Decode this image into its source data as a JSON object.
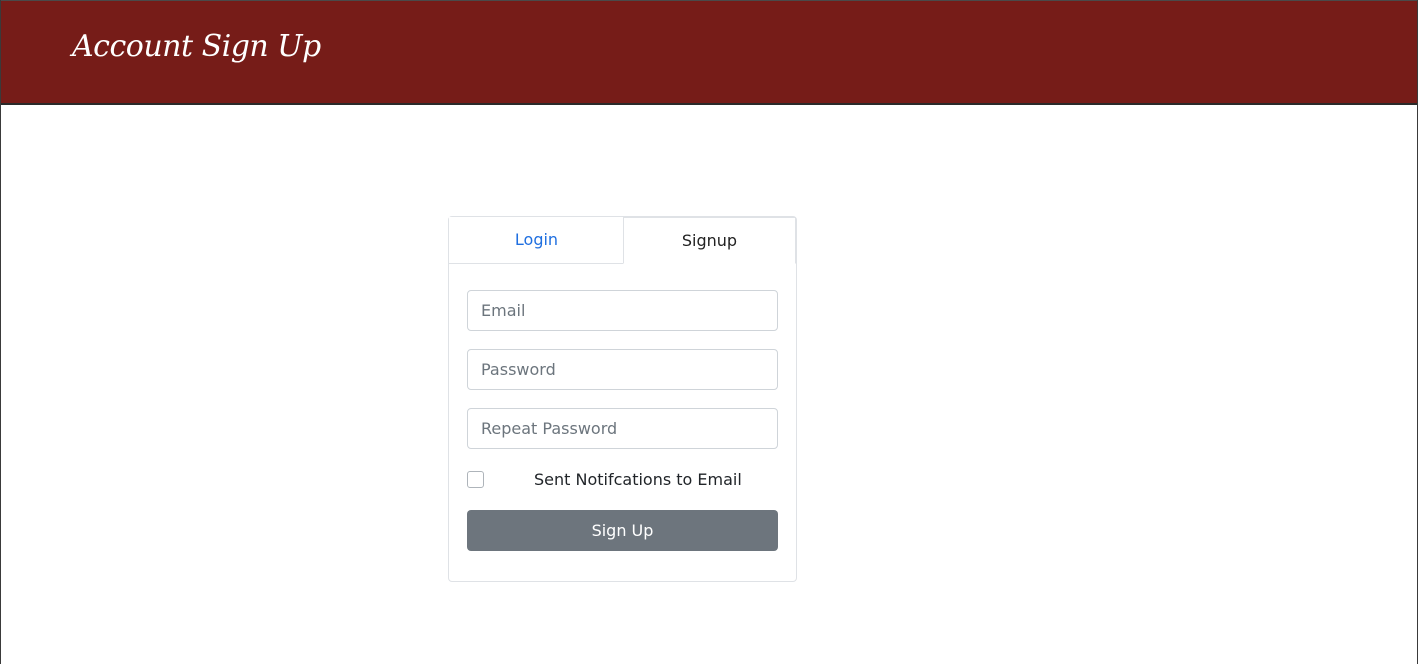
{
  "header": {
    "title": "Account Sign Up",
    "background_color": "#761c18"
  },
  "tabs": [
    {
      "label": "Login",
      "active": false,
      "color": "#1f6fe0"
    },
    {
      "label": "Signup",
      "active": true,
      "color": "#222222"
    }
  ],
  "form": {
    "email": {
      "placeholder": "Email",
      "value": ""
    },
    "password": {
      "placeholder": "Password",
      "value": ""
    },
    "repeat_password": {
      "placeholder": "Repeat Password",
      "value": ""
    },
    "notifications": {
      "label": "Sent Notifcations to Email",
      "checked": false
    },
    "submit_label": "Sign Up",
    "submit_color": "#6d757d"
  }
}
